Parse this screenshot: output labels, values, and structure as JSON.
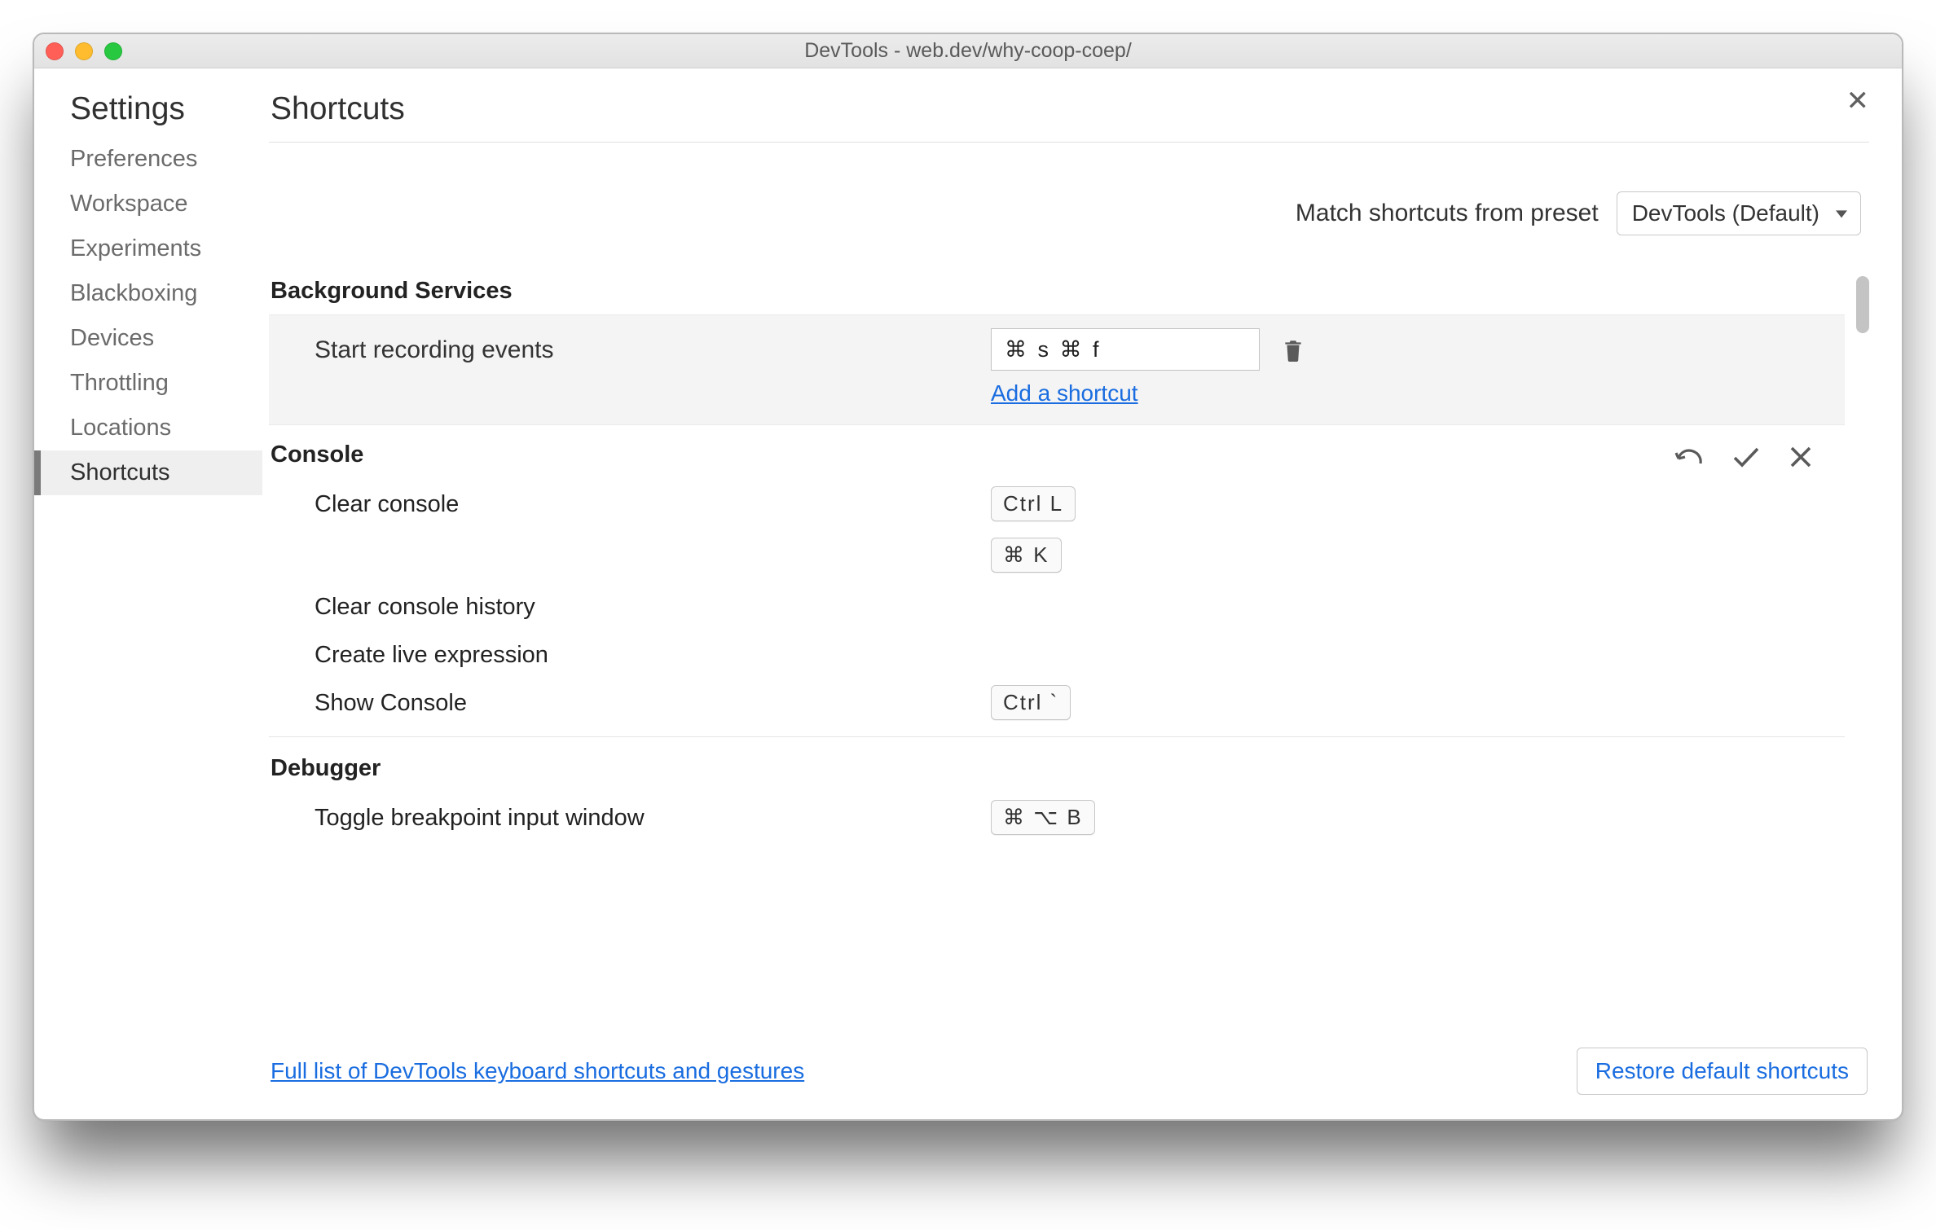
{
  "window": {
    "title": "DevTools - web.dev/why-coop-coep/"
  },
  "sidebar": {
    "title": "Settings",
    "items": [
      {
        "label": "Preferences"
      },
      {
        "label": "Workspace"
      },
      {
        "label": "Experiments"
      },
      {
        "label": "Blackboxing"
      },
      {
        "label": "Devices"
      },
      {
        "label": "Throttling"
      },
      {
        "label": "Locations"
      },
      {
        "label": "Shortcuts"
      }
    ]
  },
  "page": {
    "title": "Shortcuts",
    "preset_label": "Match shortcuts from preset",
    "preset_value": "DevTools (Default)"
  },
  "sections": {
    "bg": {
      "title": "Background Services",
      "r0": {
        "label": "Start recording events",
        "input_value": "⌘ s ⌘ f",
        "add_link": "Add a shortcut"
      }
    },
    "console": {
      "title": "Console",
      "r0": {
        "label": "Clear console",
        "k1": "Ctrl L",
        "k2": "⌘ K"
      },
      "r1": {
        "label": "Clear console history"
      },
      "r2": {
        "label": "Create live expression"
      },
      "r3": {
        "label": "Show Console",
        "k1": "Ctrl `"
      }
    },
    "debugger": {
      "title": "Debugger",
      "r0": {
        "label": "Toggle breakpoint input window",
        "k1": "⌘ ⌥ B"
      }
    }
  },
  "footer": {
    "link": "Full list of DevTools keyboard shortcuts and gestures",
    "restore": "Restore default shortcuts"
  }
}
